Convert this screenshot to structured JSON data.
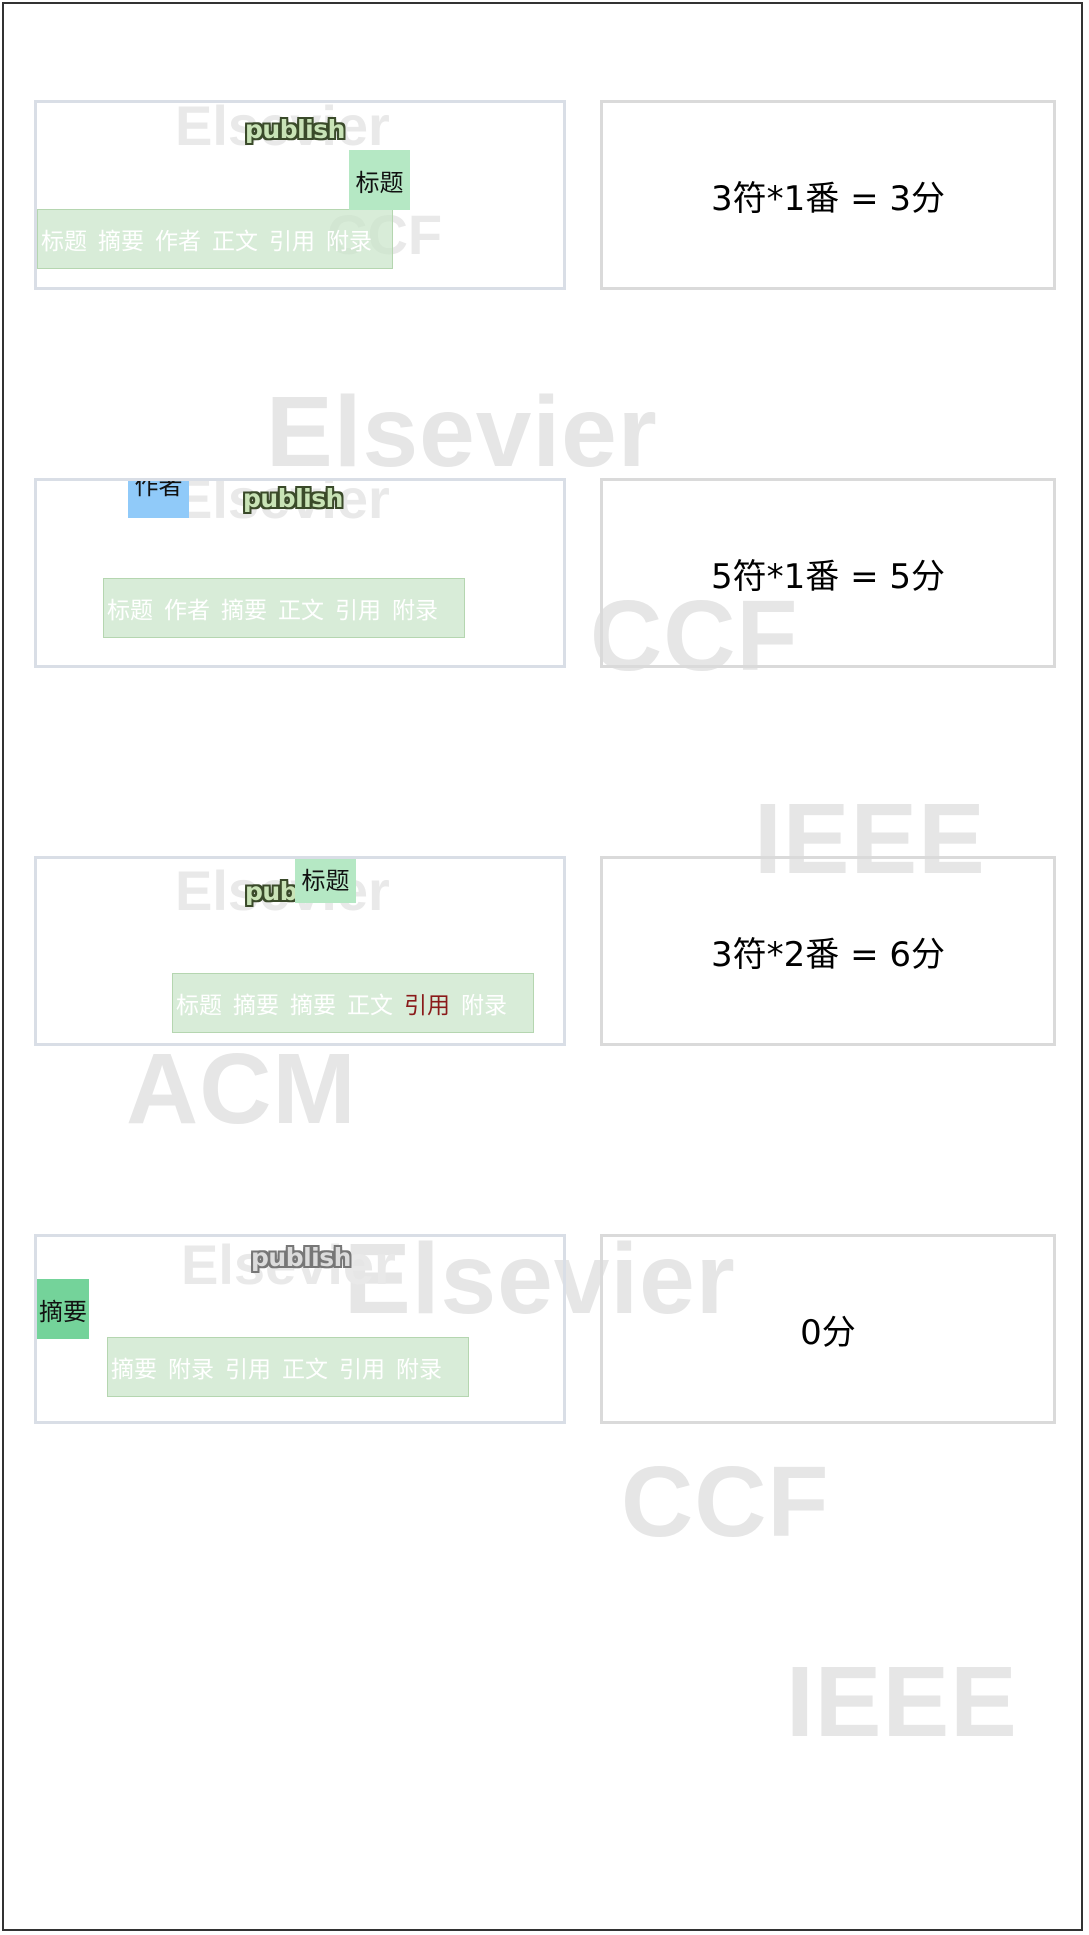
{
  "background_watermarks": [
    "Elsevier",
    "CCF",
    "IEEE",
    "ACM",
    "Elsevier",
    "CCF",
    "IEEE"
  ],
  "card_watermarks": [
    "Elsevier",
    "CCF",
    "Elsevier",
    "Elsevier",
    "Elsevier"
  ],
  "rounds": [
    {
      "publish_label": "publish",
      "falling_piece": "标题",
      "sequence": [
        "标题",
        "摘要",
        "作者",
        "正文",
        "引用",
        "附录"
      ],
      "score": "3符*1番 = 3分"
    },
    {
      "publish_label": "publish",
      "falling_piece": "作者",
      "sequence": [
        "标题",
        "作者",
        "摘要",
        "正文",
        "引用",
        "附录"
      ],
      "score": "5符*1番 = 5分"
    },
    {
      "publish_label": "publish",
      "falling_piece": "标题",
      "sequence": [
        "标题",
        "摘要",
        "摘要",
        "正文",
        "引用",
        "附录"
      ],
      "highlighted_item": "引用",
      "score": "3符*2番 = 6分"
    },
    {
      "publish_label": "publish",
      "falling_piece": "摘要",
      "sequence": [
        "摘要",
        "附录",
        "引用",
        "正文",
        "引用",
        "附录"
      ],
      "score": "0分"
    }
  ],
  "colors": {
    "piece_light_green": "#b5e8c4",
    "piece_blue": "#90caf9",
    "piece_green": "#74d39a",
    "strip": "#c9e5c9",
    "highlight_red": "#8a1a1a"
  }
}
